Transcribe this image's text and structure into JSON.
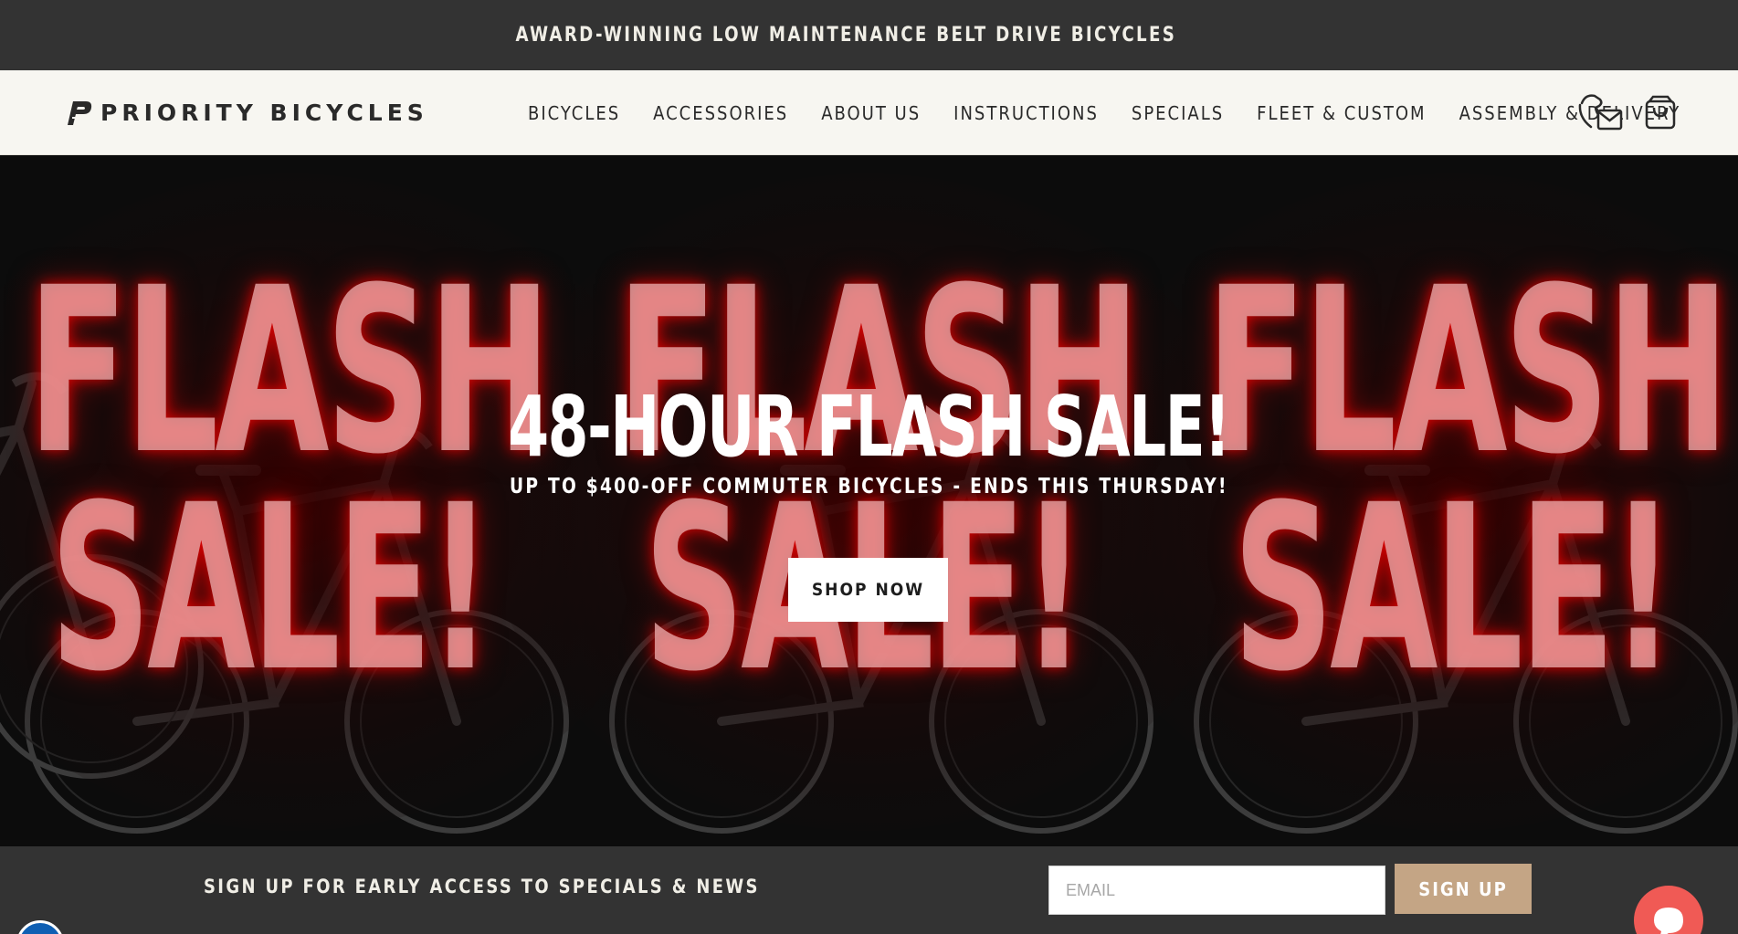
{
  "announcement": {
    "text": "AWARD-WINNING LOW MAINTENANCE BELT DRIVE BICYCLES"
  },
  "header": {
    "logo_text": "PRIORITY BICYCLES",
    "nav": [
      {
        "label": "BICYCLES"
      },
      {
        "label": "ACCESSORIES"
      },
      {
        "label": "ABOUT US"
      },
      {
        "label": "INSTRUCTIONS"
      },
      {
        "label": "SPECIALS"
      },
      {
        "label": "FLEET & CUSTOM"
      },
      {
        "label": "ASSEMBLY & DELIVERY"
      }
    ],
    "icons": {
      "contact": "contact-phone-mail-icon",
      "cart": "shopping-bag-icon"
    }
  },
  "hero": {
    "background_words": [
      "FLASH",
      "SALE!"
    ],
    "title": "48-HOUR FLASH SALE!",
    "subtitle": "UP TO $400-OFF COMMUTER BICYCLES - ENDS THIS THURSDAY!",
    "cta_label": "SHOP NOW",
    "glow_color": "#ff0000"
  },
  "signup": {
    "text": "SIGN UP FOR EARLY ACCESS TO SPECIALS & NEWS",
    "email_placeholder": "EMAIL",
    "button_label": "SIGN UP",
    "button_color": "#c4a585"
  },
  "colors": {
    "dark_bar": "#333333",
    "header_bg": "#f7f6f1",
    "chat_bubble": "#f05a55"
  }
}
